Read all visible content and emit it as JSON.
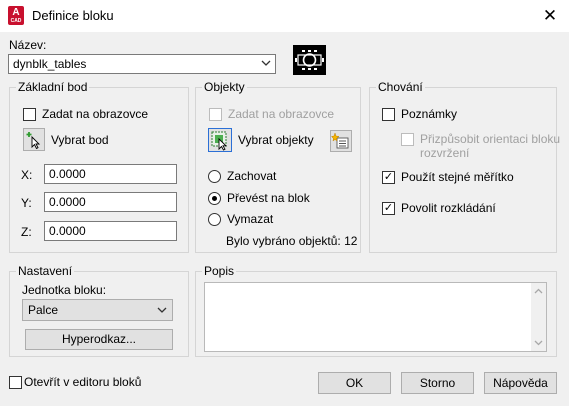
{
  "window": {
    "title": "Definice bloku",
    "app_icon_letter": "A",
    "app_icon_sub": "CAD",
    "close_glyph": "✕"
  },
  "name_section": {
    "label": "Název:",
    "value": "dynblk_tables"
  },
  "base_point": {
    "title": "Základní bod",
    "specify_onscreen": "Zadat na obrazovce",
    "specify_onscreen_checked": false,
    "pick_point": "Vybrat bod",
    "x_label": "X:",
    "x_value": "0.0000",
    "y_label": "Y:",
    "y_value": "0.0000",
    "z_label": "Z:",
    "z_value": "0.0000"
  },
  "objects": {
    "title": "Objekty",
    "specify_onscreen": "Zadat na obrazovce",
    "specify_onscreen_checked": false,
    "select_objects": "Vybrat objekty",
    "retain": "Zachovat",
    "convert": "Převést na blok",
    "delete": "Vymazat",
    "selected": "convert",
    "count_text": "Bylo vybráno objektů: 12"
  },
  "behavior": {
    "title": "Chování",
    "annotative": "Poznámky",
    "annotative_checked": false,
    "match_orientation_line1": "Přizpůsobit orientaci bloku",
    "match_orientation_line2": "rozvržení",
    "match_orientation_checked": false,
    "scale_uniformly": "Použít stejné měřítko",
    "scale_uniformly_checked": true,
    "allow_explode": "Povolit rozkládání",
    "allow_explode_checked": true
  },
  "settings": {
    "title": "Nastavení",
    "unit_label": "Jednotka bloku:",
    "unit_value": "Palce",
    "hyperlink": "Hyperodkaz..."
  },
  "description": {
    "title": "Popis",
    "value": ""
  },
  "footer": {
    "open_in_editor": "Otevřít v editoru bloků",
    "open_in_editor_checked": false,
    "ok": "OK",
    "cancel": "Storno",
    "help": "Nápověda"
  },
  "glyphs": {
    "check": "✓",
    "dropdown": "⌄"
  }
}
